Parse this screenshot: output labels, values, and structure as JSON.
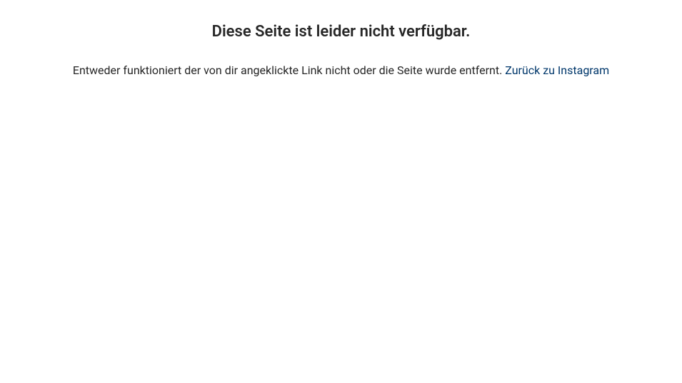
{
  "error": {
    "title": "Diese Seite ist leider nicht verfügbar.",
    "message": "Entweder funktioniert der von dir angeklickte Link nicht oder die Seite wurde entfernt. ",
    "link_text": "Zurück zu Instagram"
  }
}
